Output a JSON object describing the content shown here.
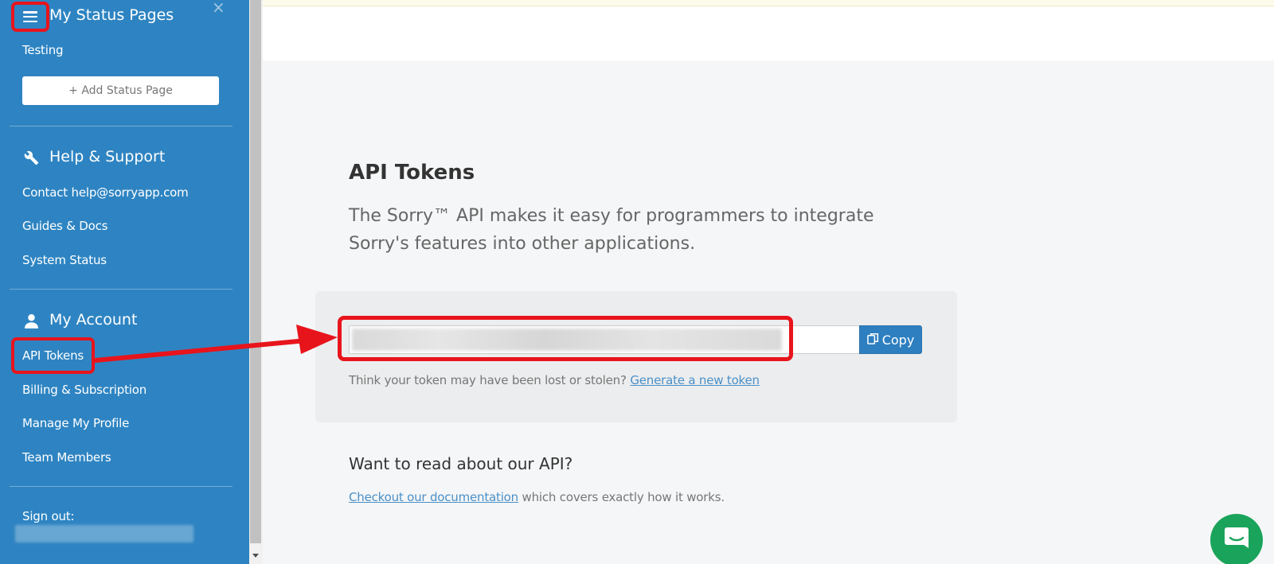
{
  "sidebar": {
    "status_pages_heading": "My Status Pages",
    "status_pages": [
      "Testing"
    ],
    "add_status_page_label": "+ Add Status Page",
    "help_heading": "Help & Support",
    "help_items": [
      "Contact help@sorryapp.com",
      "Guides & Docs",
      "System Status"
    ],
    "account_heading": "My Account",
    "account_items": [
      "API Tokens",
      "Billing & Subscription",
      "Manage My Profile",
      "Team Members"
    ],
    "sign_out_label": "Sign out:"
  },
  "main": {
    "title": "API Tokens",
    "description": "The Sorry™ API makes it easy for programmers to integrate Sorry's features into other applications.",
    "copy_label": "Copy",
    "lost_text": "Think your token may have been lost or stolen?",
    "generate_link": "Generate a new token",
    "read_title": "Want to read about our API?",
    "doc_link": "Checkout our documentation",
    "doc_text": "which covers exactly how it works."
  },
  "colors": {
    "sidebar_bg": "#2e84c2",
    "highlight": "#e8141c",
    "copy_button": "#2e7fc0",
    "chat_button": "#1aa45b",
    "link": "#4a90c8"
  },
  "icons": [
    "hamburger-icon",
    "close-icon",
    "wrench-icon",
    "user-icon",
    "copy-icon",
    "chat-icon"
  ]
}
